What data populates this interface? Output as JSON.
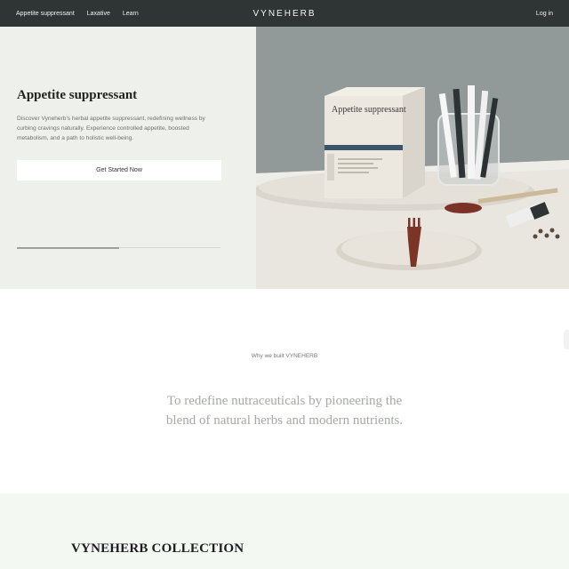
{
  "nav": {
    "links": [
      "Appetite suppressant",
      "Laxative",
      "Learn"
    ],
    "brand": "VYNEHERB",
    "login": "Log in"
  },
  "hero": {
    "title": "Appetite suppressant",
    "description": "Discover Vyneherb’s herbal appetite suppressant, redefining wellness by curbing cravings naturally. Experience controlled appetite, boosted metabolism, and a path to holistic well-being.",
    "cta": "Get Started Now",
    "carousel_progress": 0.5,
    "product_box_text": "Appetite suppressant"
  },
  "mission": {
    "kicker": "Why we built VYNEHERB",
    "statement": "To redefine nutraceuticals by pioneering the blend of natural herbs and modern nutrients."
  },
  "collection": {
    "title": "VYNEHERB COLLECTION"
  },
  "colors": {
    "nav_bg": "#2f3434",
    "hero_left_bg": "#eef0eb",
    "collection_bg": "#f3f8f3",
    "muted_text": "#a6a9a5"
  }
}
